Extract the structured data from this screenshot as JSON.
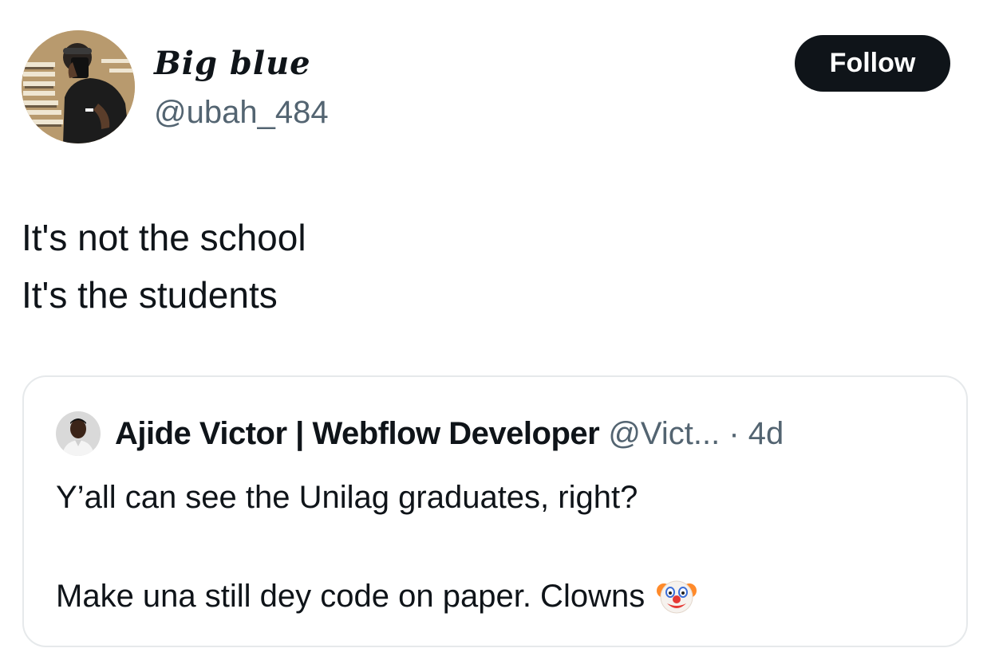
{
  "author": {
    "display_name": "Big blue",
    "handle": "@ubah_484",
    "avatar_icon": "profile-photo"
  },
  "follow_button": {
    "label": "Follow"
  },
  "tweet": {
    "lines": [
      "It's not the school",
      "It's the students"
    ]
  },
  "quoted_tweet": {
    "author_name": "Ajide Victor | Webflow Developer",
    "handle": "@Vict...",
    "separator": "·",
    "time": "4d",
    "line1": "Y’all can see the Unilag graduates, right?",
    "line2": "Make una still dey code on paper. Clowns",
    "emoji_icon": "clown-face-icon"
  },
  "colors": {
    "text": "#0f1419",
    "secondary": "#536471",
    "button_bg": "#0f1419",
    "border": "#e6e9eb"
  }
}
